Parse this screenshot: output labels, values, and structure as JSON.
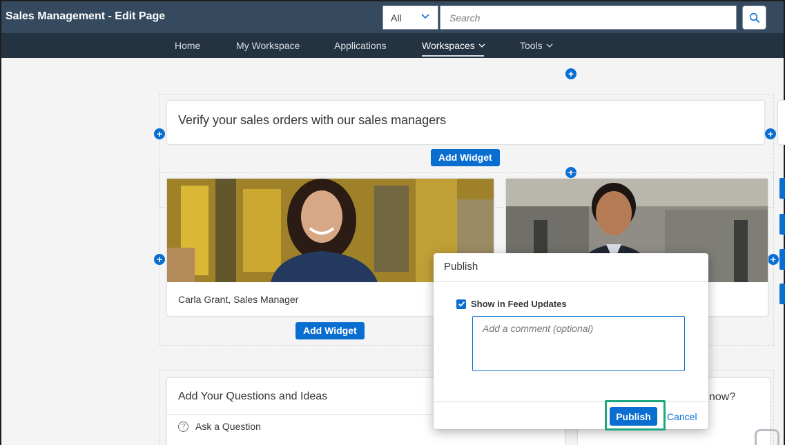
{
  "header": {
    "title": "Sales Management - Edit Page",
    "scope": "All",
    "search_placeholder": "Search"
  },
  "nav": {
    "items": [
      {
        "label": "Home"
      },
      {
        "label": "My Workspace"
      },
      {
        "label": "Applications"
      },
      {
        "label": "Workspaces"
      },
      {
        "label": "Tools"
      }
    ],
    "active": "Workspaces"
  },
  "page": {
    "hero_text": "Verify your sales orders with our sales managers",
    "add_widget_label": "Add Widget",
    "person1_caption": "Carla Grant, Sales Manager",
    "questions_title": "Add Your Questions and Ideas",
    "questions_item": "Ask a Question",
    "partial_right_heading": "now?"
  },
  "dialog": {
    "title": "Publish",
    "checkbox_label": "Show in Feed Updates",
    "checkbox_checked": true,
    "comment_placeholder": "Add a comment (optional)",
    "publish_label": "Publish",
    "cancel_label": "Cancel"
  },
  "colors": {
    "shell_header": "#354a5f",
    "nav_bar": "#243342",
    "accent": "#0a6ed1",
    "highlight": "#1ea77f"
  }
}
